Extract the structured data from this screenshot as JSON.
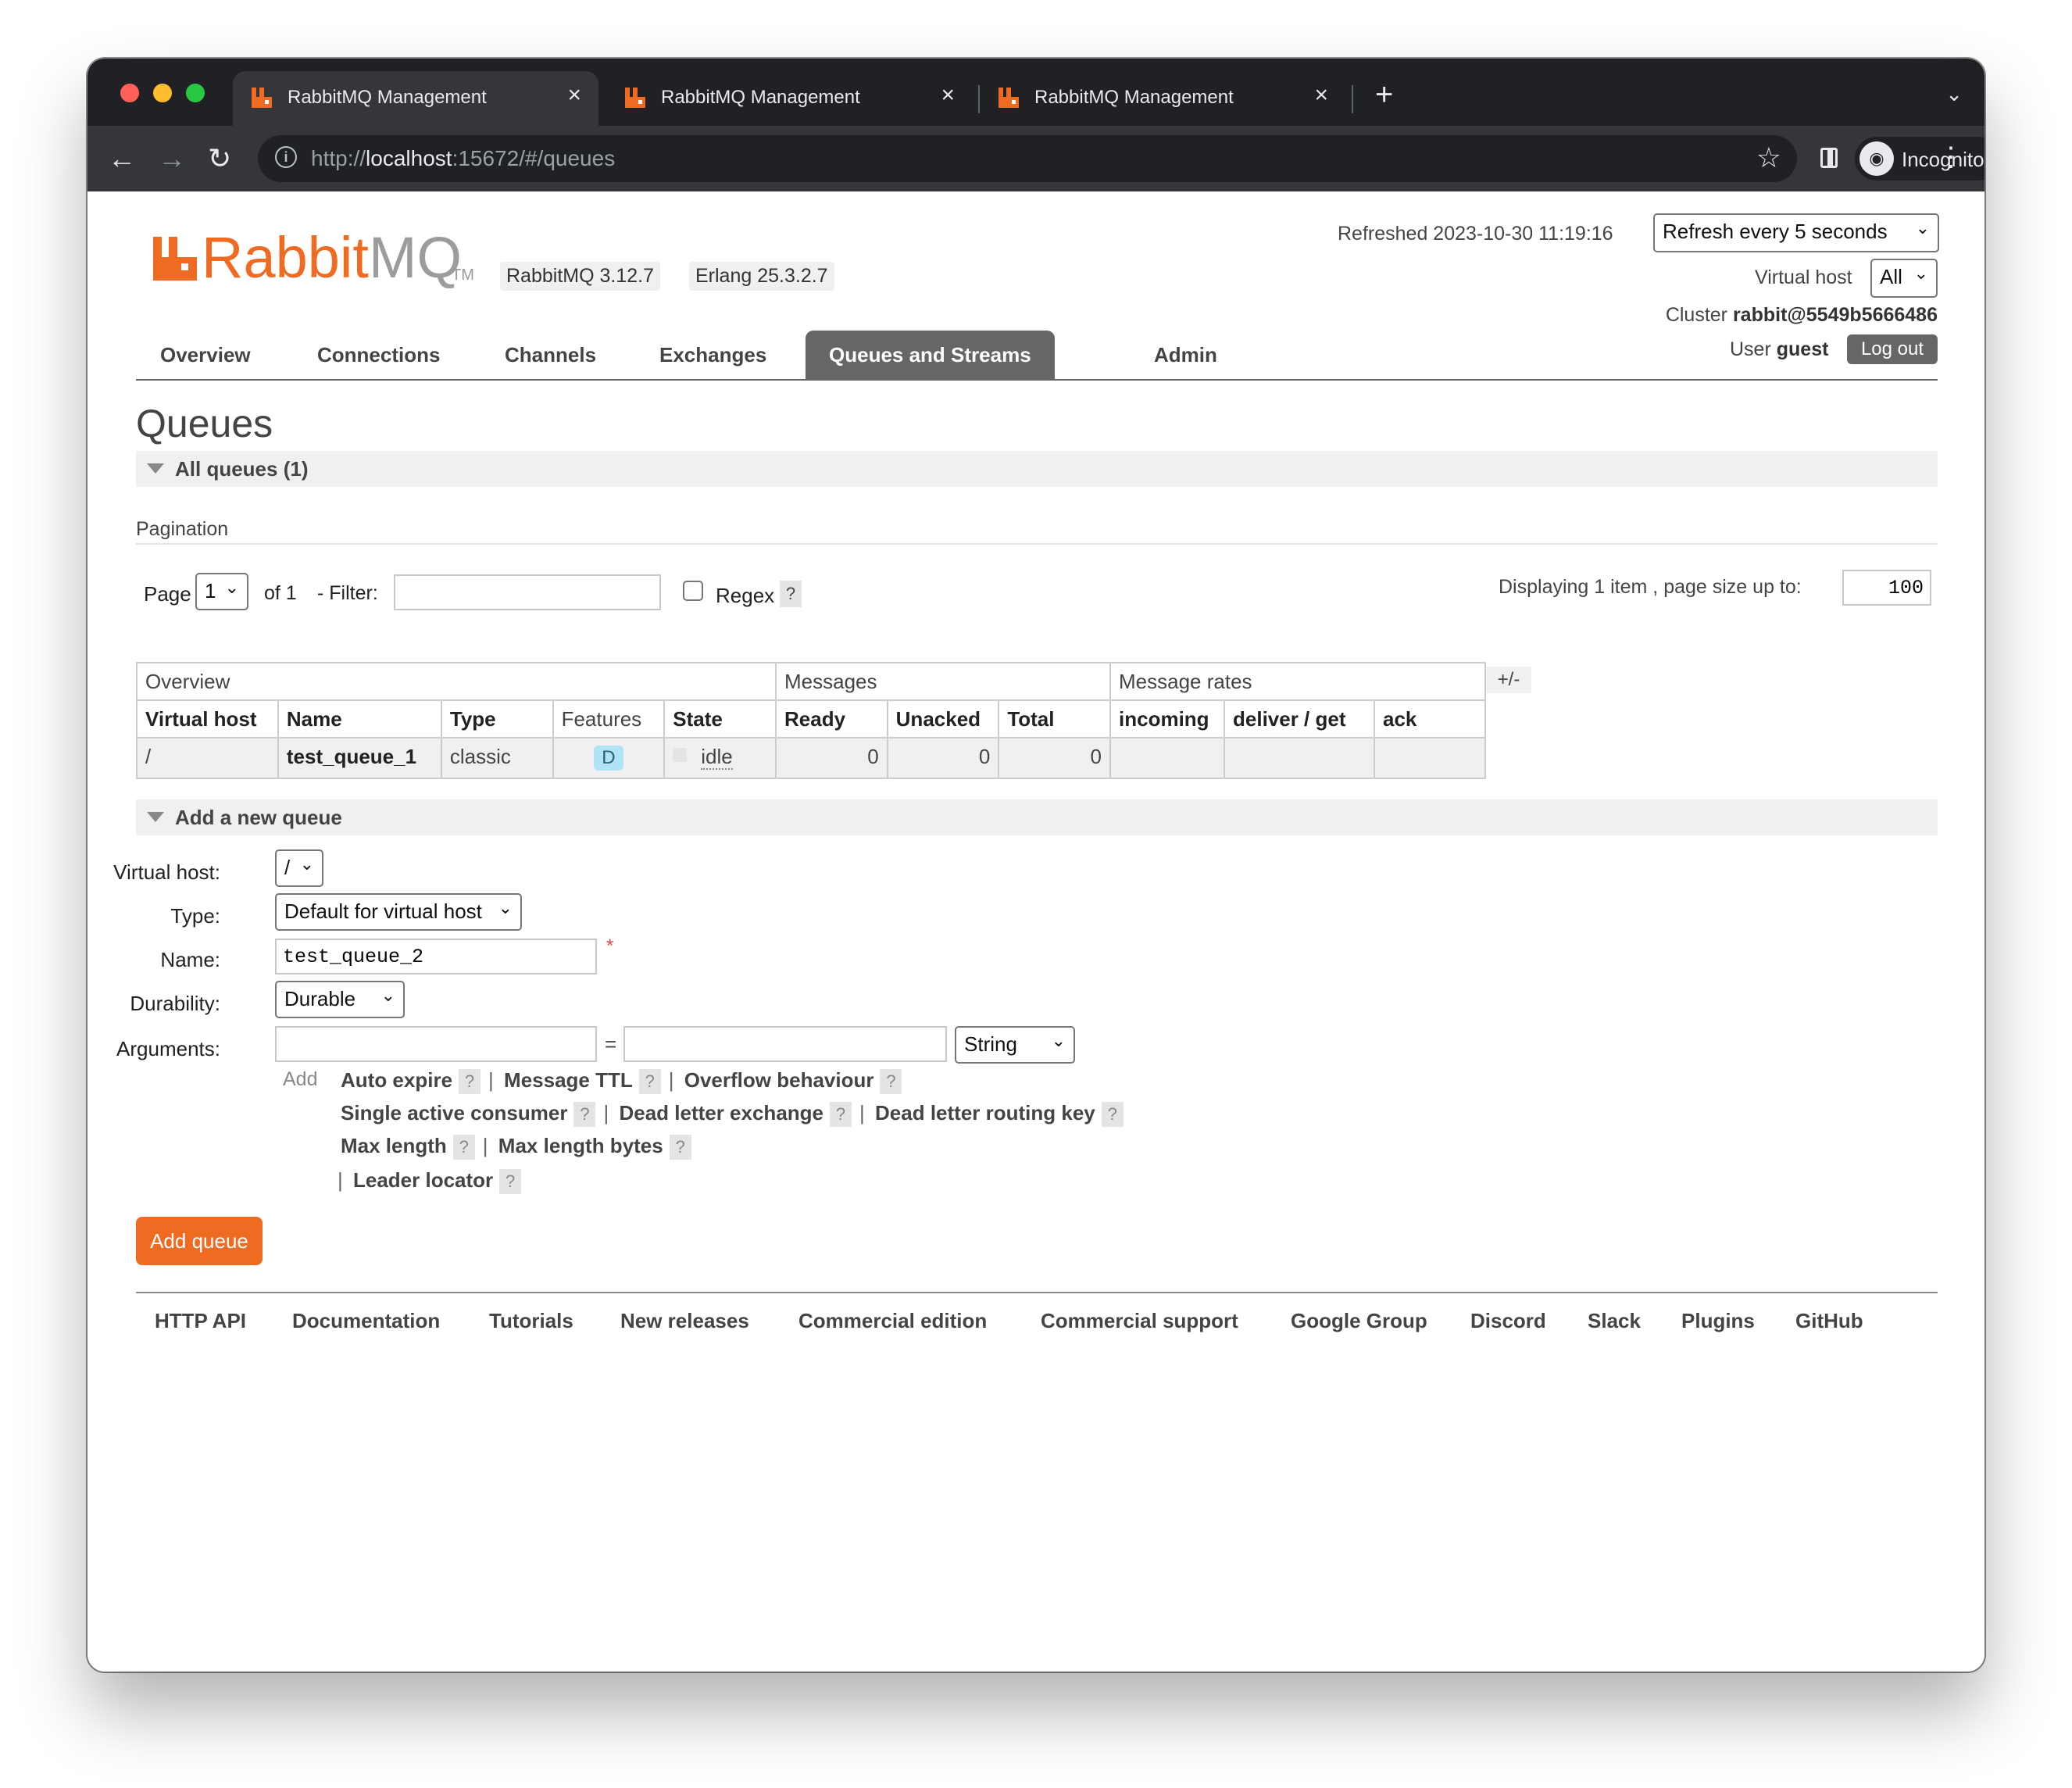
{
  "browser": {
    "tabs": [
      {
        "title": "RabbitMQ Management",
        "active": true
      },
      {
        "title": "RabbitMQ Management",
        "active": false
      },
      {
        "title": "RabbitMQ Management",
        "active": false
      }
    ],
    "url_prefix": "http://",
    "url_host": "localhost",
    "url_rest": ":15672/#/queues",
    "profile_label": "Incognito",
    "accent": "#f06b22"
  },
  "header": {
    "logo_main": "Rabbit",
    "logo_mq": "MQ",
    "logo_tm": "TM",
    "version": "RabbitMQ 3.12.7",
    "erlang": "Erlang 25.3.2.7",
    "refreshed_label": "Refreshed 2023-10-30 11:19:16",
    "refresh_select": "Refresh every 5 seconds",
    "vhost_label": "Virtual host",
    "vhost_select": "All",
    "cluster_label": "Cluster",
    "cluster_name": "rabbit@5549b5666486",
    "user_label": "User",
    "user_name": "guest",
    "logout_label": "Log out"
  },
  "nav": [
    {
      "label": "Overview"
    },
    {
      "label": "Connections"
    },
    {
      "label": "Channels"
    },
    {
      "label": "Exchanges"
    },
    {
      "label": "Queues and Streams",
      "active": true
    },
    {
      "label": "Admin"
    }
  ],
  "page": {
    "title": "Queues",
    "all_queues_label": "All queues (1)",
    "pagination_label": "Pagination",
    "page_label": "Page",
    "page_value": "1",
    "of_label": "of 1",
    "filter_label": "- Filter:",
    "filter_value": "",
    "regex_label": "Regex",
    "help_mark": "?",
    "displaying_label": "Displaying 1 item , page size up to:",
    "page_size": "100"
  },
  "table": {
    "groups": [
      "Overview",
      "Messages",
      "Message rates"
    ],
    "plus_minus": "+/-",
    "columns": [
      "Virtual host",
      "Name",
      "Type",
      "Features",
      "State",
      "Ready",
      "Unacked",
      "Total",
      "incoming",
      "deliver / get",
      "ack"
    ],
    "rows": [
      {
        "vhost": "/",
        "name": "test_queue_1",
        "type": "classic",
        "features": "D",
        "state": "idle",
        "ready": "0",
        "unacked": "0",
        "total": "0",
        "incoming": "",
        "deliver_get": "",
        "ack": ""
      }
    ]
  },
  "add_queue": {
    "section_label": "Add a new queue",
    "vhost_label": "Virtual host:",
    "vhost_value": "/",
    "type_label": "Type:",
    "type_value": "Default for virtual host",
    "name_label": "Name:",
    "name_value": "test_queue_2",
    "required_mark": "*",
    "durability_label": "Durability:",
    "durability_value": "Durable",
    "arguments_label": "Arguments:",
    "arg_key": "",
    "arg_equals": "=",
    "arg_value": "",
    "arg_type": "String",
    "add_label": "Add",
    "arg_links": [
      "Auto expire",
      "Message TTL",
      "Overflow behaviour",
      "Single active consumer",
      "Dead letter exchange",
      "Dead letter routing key",
      "Max length",
      "Max length bytes",
      "Leader locator"
    ],
    "separator": "|",
    "submit_label": "Add queue"
  },
  "footer": [
    "HTTP API",
    "Documentation",
    "Tutorials",
    "New releases",
    "Commercial edition",
    "Commercial support",
    "Google Group",
    "Discord",
    "Slack",
    "Plugins",
    "GitHub"
  ]
}
